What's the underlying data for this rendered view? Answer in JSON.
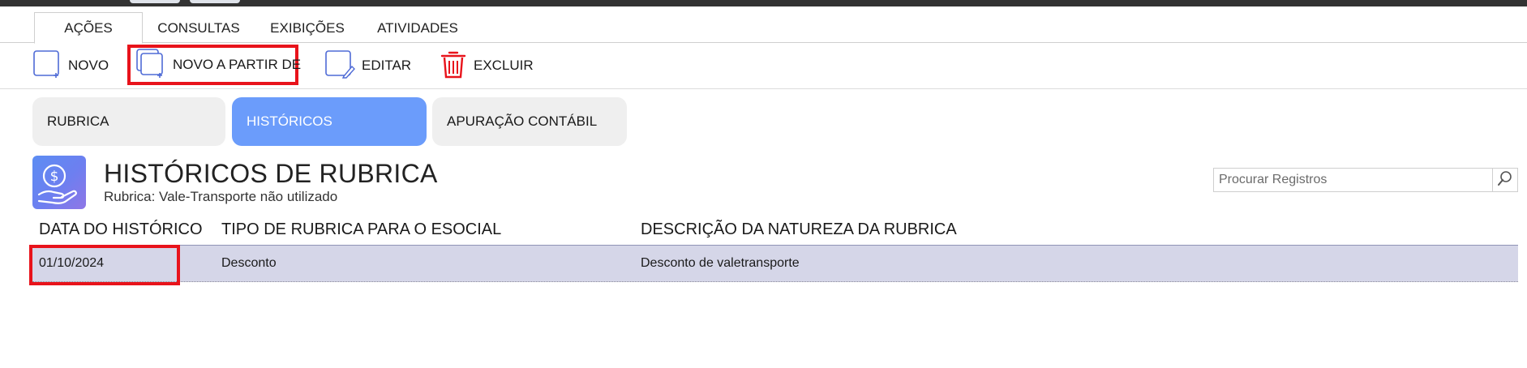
{
  "menu_tabs": [
    {
      "label": "AÇÕES",
      "active": true
    },
    {
      "label": "CONSULTAS",
      "active": false
    },
    {
      "label": "EXIBIÇÕES",
      "active": false
    },
    {
      "label": "ATIVIDADES",
      "active": false
    }
  ],
  "toolbar": {
    "novo_label": "NOVO",
    "novo_a_partir_label": "NOVO A PARTIR DE",
    "editar_label": "EDITAR",
    "excluir_label": "EXCLUIR"
  },
  "segment_tabs": [
    {
      "label": "RUBRICA",
      "active": false
    },
    {
      "label": "HISTÓRICOS",
      "active": true
    },
    {
      "label": "APURAÇÃO CONTÁBIL",
      "active": false
    }
  ],
  "page": {
    "icon": "money-hand-icon",
    "title": "HISTÓRICOS DE RUBRICA",
    "subtitle": "Rubrica: Vale-Transporte não utilizado"
  },
  "search": {
    "placeholder": "Procurar Registros",
    "value": ""
  },
  "table": {
    "columns": [
      "DATA DO HISTÓRICO",
      "TIPO DE RUBRICA PARA O ESOCIAL",
      "DESCRIÇÃO DA NATUREZA DA RUBRICA"
    ],
    "rows": [
      {
        "data": "01/10/2024",
        "tipo": "Desconto",
        "descricao": "Desconto de valetransporte"
      }
    ]
  },
  "colors": {
    "accent": "#6b9cfb",
    "highlight": "#e8131b",
    "row_selected": "#d5d6e8",
    "topbar": "#333333"
  }
}
